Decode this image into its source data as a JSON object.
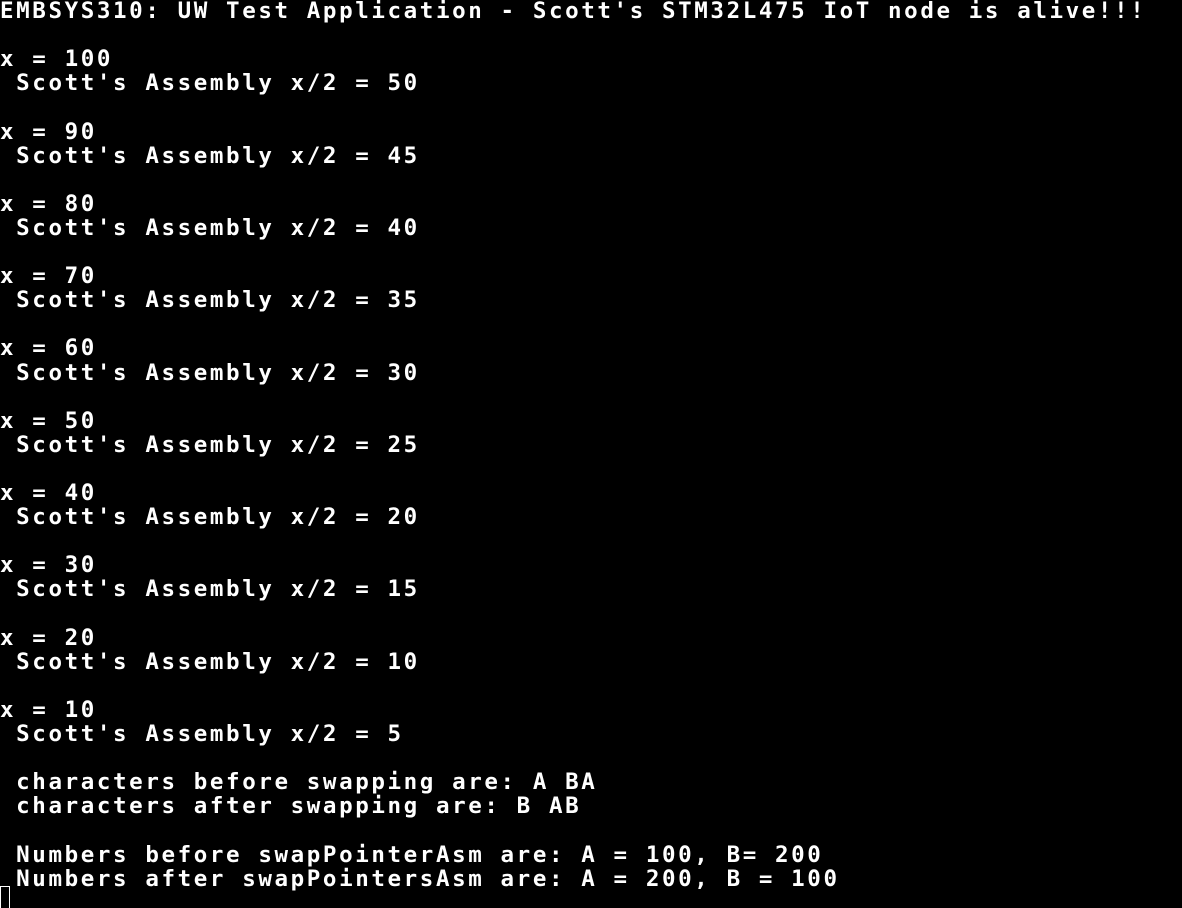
{
  "terminal": {
    "colors": {
      "background": "#000000",
      "foreground": "#ffffff"
    },
    "lines": [
      "EMBSYS310: UW Test Application - Scott's STM32L475 IoT node is alive!!!",
      "",
      "x = 100",
      " Scott's Assembly x/2 = 50",
      "",
      "x = 90",
      " Scott's Assembly x/2 = 45",
      "",
      "x = 80",
      " Scott's Assembly x/2 = 40",
      "",
      "x = 70",
      " Scott's Assembly x/2 = 35",
      "",
      "x = 60",
      " Scott's Assembly x/2 = 30",
      "",
      "x = 50",
      " Scott's Assembly x/2 = 25",
      "",
      "x = 40",
      " Scott's Assembly x/2 = 20",
      "",
      "x = 30",
      " Scott's Assembly x/2 = 15",
      "",
      "x = 20",
      " Scott's Assembly x/2 = 10",
      "",
      "x = 10",
      " Scott's Assembly x/2 = 5",
      "",
      " characters before swapping are: A BA",
      " characters after swapping are: B AB",
      "",
      " Numbers before swapPointerAsm are: A = 100, B= 200",
      " Numbers after swapPointersAsm are: A = 200, B = 100"
    ]
  }
}
